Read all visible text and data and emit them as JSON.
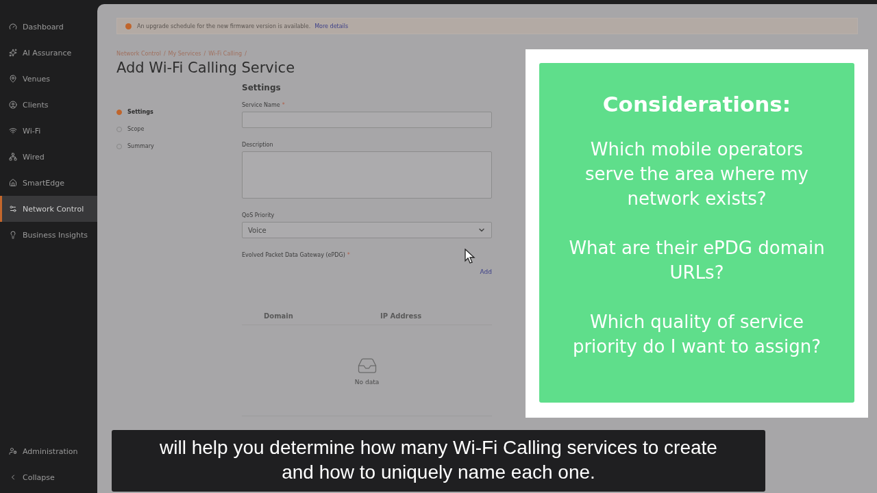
{
  "sidebar": {
    "items": [
      {
        "label": "Dashboard",
        "selected": false
      },
      {
        "label": "AI Assurance",
        "selected": false
      },
      {
        "label": "Venues",
        "selected": false
      },
      {
        "label": "Clients",
        "selected": false
      },
      {
        "label": "Wi-Fi",
        "selected": false
      },
      {
        "label": "Wired",
        "selected": false
      },
      {
        "label": "SmartEdge",
        "selected": false
      },
      {
        "label": "Network Control",
        "selected": true
      },
      {
        "label": "Business Insights",
        "selected": false
      }
    ],
    "footer": [
      {
        "label": "Administration"
      },
      {
        "label": "Collapse"
      }
    ]
  },
  "banner": {
    "message": "An upgrade schedule for the new firmware version is available.",
    "link": "More details"
  },
  "breadcrumb": {
    "items": [
      "Network Control",
      "My Services",
      "Wi-Fi Calling"
    ],
    "separator": "/"
  },
  "title": "Add Wi-Fi Calling Service",
  "steps": [
    {
      "label": "Settings",
      "selected": true
    },
    {
      "label": "Scope",
      "selected": false
    },
    {
      "label": "Summary",
      "selected": false
    }
  ],
  "form": {
    "heading": "Settings",
    "required_mark": "*",
    "fields": [
      {
        "kind": "text",
        "label": "Service Name",
        "required": true
      },
      {
        "kind": "textarea",
        "label": "Description",
        "required": false
      },
      {
        "kind": "select",
        "label": "QoS Priority",
        "value": "Voice"
      }
    ],
    "epdg": {
      "label": "Evolved Packet Data Gateway (ePDG)",
      "required": true,
      "add": "Add",
      "columns": [
        "Domain",
        "IP Address"
      ],
      "empty": "No data"
    }
  },
  "overlay": {
    "title": "Considerations:",
    "questions": [
      [
        "Which mobile operators",
        "serve the area where my",
        "network exists?"
      ],
      [
        "What are their ePDG domain",
        "URLs?"
      ],
      [
        "Which quality of service",
        "priority do I want to assign?"
      ]
    ]
  },
  "caption": [
    "will help you determine how many Wi-Fi Calling services to create",
    "and how to uniquely name each one."
  ]
}
